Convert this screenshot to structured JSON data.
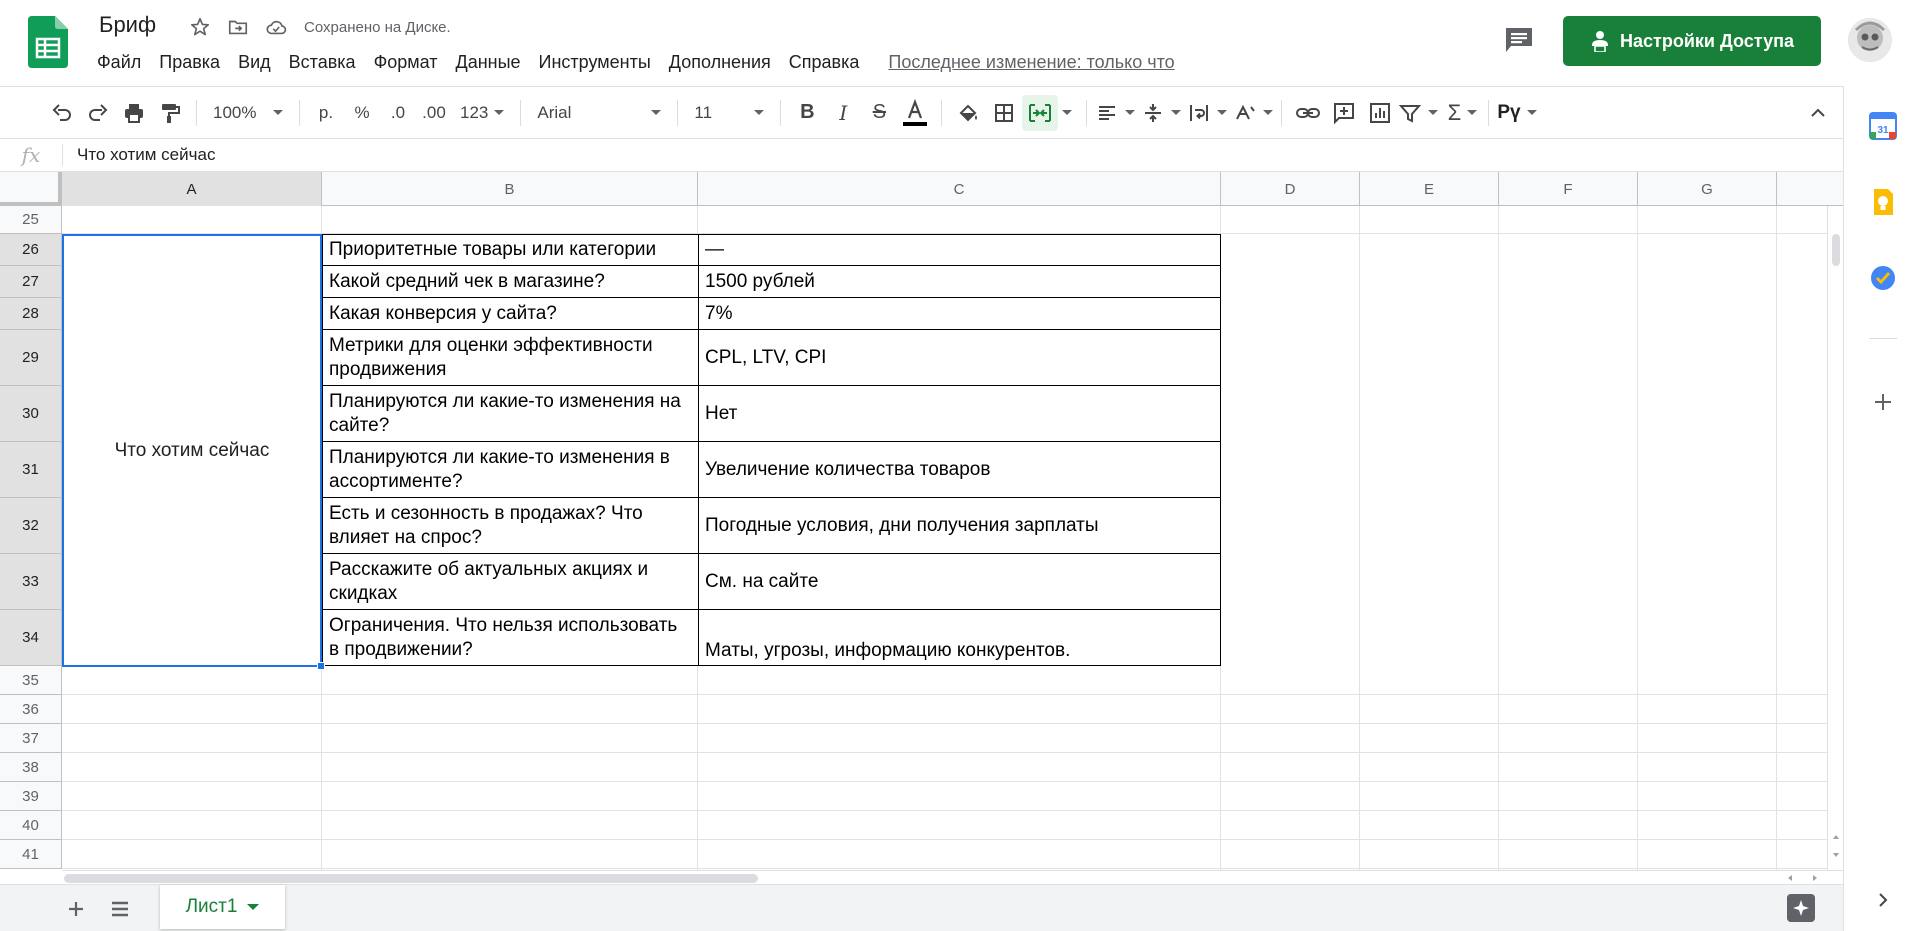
{
  "header": {
    "doc_title": "Бриф",
    "saved_status": "Сохранено на Диске.",
    "menu": [
      "Файл",
      "Правка",
      "Вид",
      "Вставка",
      "Формат",
      "Данные",
      "Инструменты",
      "Дополнения",
      "Справка"
    ],
    "last_edit": "Последнее изменение: только что",
    "share_label": "Настройки Доступа"
  },
  "toolbar": {
    "zoom": "100%",
    "currency": "р.",
    "percent": "%",
    "decimal_decrease": ".0",
    "decimal_increase": ".00",
    "more_formats": "123",
    "font_family": "Arial",
    "font_size": "11",
    "input_tools": "Рү"
  },
  "formula_bar": {
    "fx": "fx",
    "content": "Что хотим сейчас"
  },
  "grid": {
    "columns": [
      "A",
      "B",
      "C",
      "D",
      "E",
      "F",
      "G"
    ],
    "selected_column": "A",
    "rows": [
      "25",
      "26",
      "27",
      "28",
      "29",
      "30",
      "31",
      "32",
      "33",
      "34",
      "35",
      "36",
      "37",
      "38",
      "39",
      "40",
      "41"
    ],
    "merged_a": "Что хотим сейчас",
    "table": [
      {
        "row": "26",
        "question": "Приоритетные товары или категории",
        "answer": "—"
      },
      {
        "row": "27",
        "question": "Какой средний чек в магазине?",
        "answer": "1500 рублей"
      },
      {
        "row": "28",
        "question": "Какая конверсия у сайта?",
        "answer": "7%"
      },
      {
        "row": "29",
        "question": "Метрики для оценки эффективности продвижения",
        "answer": "CPL, LTV, CPI"
      },
      {
        "row": "30",
        "question": "Планируются ли какие-то изменения на сайте?",
        "answer": "Нет"
      },
      {
        "row": "31",
        "question": "Планируются ли какие-то изменения в ассортименте?",
        "answer": "Увеличение количества товаров"
      },
      {
        "row": "32",
        "question": "Есть и сезонность в продажах? Что влияет на спрос?",
        "answer": "Погодные условия, дни получения зарплаты"
      },
      {
        "row": "33",
        "question": "Расскажите об актуальных акциях и скидках",
        "answer": "См. на сайте"
      },
      {
        "row": "34",
        "question": "Ограничения. Что нельзя использовать в продвижении?",
        "answer": "Маты, угрозы, информацию конкурентов."
      }
    ]
  },
  "sheets": {
    "active_sheet": "Лист1"
  },
  "side_panel": {
    "calendar_day": "31"
  },
  "colors": {
    "brand_green": "#188038",
    "selection_blue": "#1a73e8",
    "keep_yellow": "#fbbc04",
    "tasks_blue": "#4285f4"
  }
}
